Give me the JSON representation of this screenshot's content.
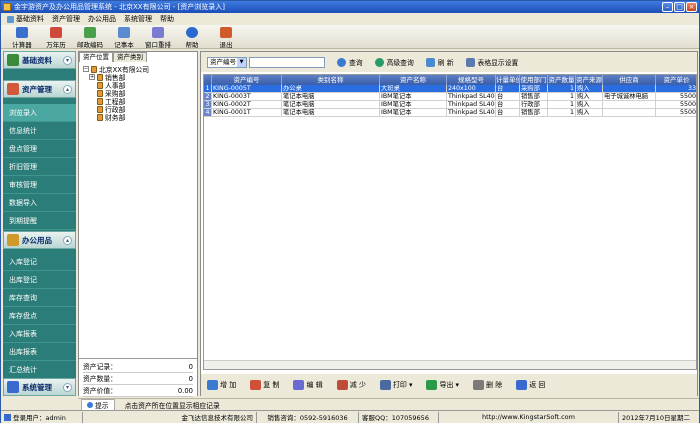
{
  "window": {
    "title": "金宇游资产及办公用品管理系统 - 北京XX有限公司 - [资产浏览录入]"
  },
  "menu": [
    {
      "label": "基础资料",
      "icon": "base-data-icon"
    },
    {
      "label": "资产管理",
      "icon": ""
    },
    {
      "label": "办公用品",
      "icon": ""
    },
    {
      "label": "系统管理",
      "icon": ""
    },
    {
      "label": "帮助",
      "icon": ""
    }
  ],
  "toolbar": [
    {
      "label": "计算器",
      "icon": "calculator-icon",
      "color": "#3a6fd0"
    },
    {
      "label": "万年历",
      "icon": "calendar-icon",
      "color": "#d04a3a"
    },
    {
      "label": "邮政编码",
      "icon": "postcode-icon",
      "color": "#4aa04a"
    },
    {
      "label": "记事本",
      "icon": "notepad-icon",
      "color": "#5a8ad0"
    },
    {
      "label": "窗口重排",
      "icon": "window-arrange-icon",
      "color": "#7a7ad0"
    },
    {
      "label": "帮助",
      "icon": "help-icon",
      "color": "#2a6ad0"
    },
    {
      "label": "退出",
      "icon": "exit-icon",
      "color": "#d05a2a"
    }
  ],
  "sidebar": {
    "sections": [
      {
        "title": "基础资料",
        "icon": "base-data-icon",
        "items": []
      },
      {
        "title": "资产管理",
        "icon": "asset-manage-icon",
        "items": [
          "浏览录入",
          "信息统计",
          "盘点管理",
          "折旧管理",
          "审核管理",
          "数据导入",
          "到期提醒"
        ]
      },
      {
        "title": "办公用品",
        "icon": "office-supplies-icon",
        "items": [
          "入库登记",
          "出库登记",
          "库存查询",
          "库存盘点",
          "入库报表",
          "出库报表",
          "汇总统计"
        ]
      },
      {
        "title": "系统管理",
        "icon": "system-manage-icon",
        "items": []
      }
    ]
  },
  "tree_panel": {
    "tabs": [
      "资产位置",
      "资产类别"
    ],
    "root": "北京XX有限公司",
    "nodes": [
      "销售部",
      "人事部",
      "采购部",
      "工程部",
      "行政部",
      "财务部"
    ],
    "stats": [
      {
        "label": "资产记录：",
        "value": "0"
      },
      {
        "label": "资产数量：",
        "value": "0"
      },
      {
        "label": "资产价值：",
        "value": "0.00"
      }
    ]
  },
  "filter": {
    "field_label": "资产编号",
    "buttons": [
      {
        "label": "查询",
        "icon": "search-icon"
      },
      {
        "label": "高级查询",
        "icon": "advanced-search-icon"
      },
      {
        "label": "刷 新",
        "icon": "refresh-icon"
      },
      {
        "label": "表格显示设置",
        "icon": "table-settings-icon"
      }
    ]
  },
  "grid": {
    "columns": [
      "资产编号",
      "类别名称",
      "资产名称",
      "规格型号",
      "计量单位",
      "使用部门",
      "资产数量",
      "资产来源",
      "供应商",
      "资产单价"
    ],
    "rows": [
      {
        "n": "1",
        "cells": [
          "KING-0005T",
          "办公桌",
          "大班桌",
          "240x100",
          "台",
          "采购部",
          "1",
          "购入",
          "",
          "33"
        ]
      },
      {
        "n": "2",
        "cells": [
          "KING-0003T",
          "笔记本电脑",
          "IBM笔记本",
          "Thinkpad SL400",
          "台",
          "销售部",
          "1",
          "购入",
          "电子城诚林电脑",
          "5500"
        ]
      },
      {
        "n": "3",
        "cells": [
          "KING-0002T",
          "笔记本电脑",
          "IBM笔记本",
          "Thinkpad SL400",
          "台",
          "行政部",
          "1",
          "购入",
          "",
          "5500"
        ]
      },
      {
        "n": "4",
        "cells": [
          "KING-0001T",
          "笔记本电脑",
          "IBM笔记本",
          "Thinkpad SL400",
          "台",
          "销售部",
          "1",
          "购入",
          "",
          "5500"
        ]
      }
    ]
  },
  "actions": [
    {
      "label": "增 加",
      "icon": "add-icon",
      "color": "#3a7ad0"
    },
    {
      "label": "复 制",
      "icon": "copy-icon",
      "color": "#d0503a"
    },
    {
      "label": "编 辑",
      "icon": "edit-icon",
      "color": "#6a6ad0"
    },
    {
      "label": "减 少",
      "icon": "reduce-icon",
      "color": "#c04a3a"
    },
    {
      "label": "打印",
      "icon": "print-icon",
      "color": "#4a6aa0"
    },
    {
      "label": "导出",
      "icon": "export-icon",
      "color": "#2a9a4a"
    },
    {
      "label": "删 除",
      "icon": "delete-icon",
      "color": "#7a7a7a"
    },
    {
      "label": "返 回",
      "icon": "return-icon",
      "color": "#3a6ad0"
    }
  ],
  "tip": {
    "label": "提示",
    "text": "点击资产所在位置显示相应记录"
  },
  "status": {
    "user": "登录用户：admin",
    "company": "金飞达信息技术有限公司",
    "sales_phone": "销售咨询：0592-5916036",
    "qq": "客服QQ：107059656",
    "website": "http://www.KingstarSoft.com",
    "date": "2012年7月10日星期二"
  }
}
